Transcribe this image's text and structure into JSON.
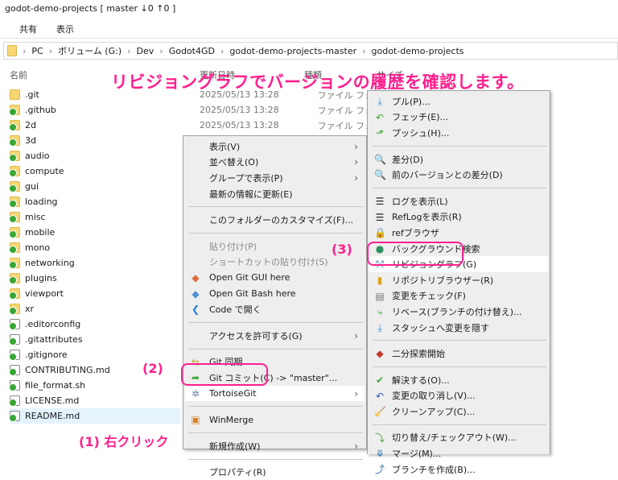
{
  "window": {
    "title": "godot-demo-projects [ master ↓0 ↑0 ]"
  },
  "ribbon": {
    "share": "共有",
    "view": "表示"
  },
  "breadcrumb": [
    "PC",
    "ボリューム (G:)",
    "Dev",
    "Godot4GD",
    "godot-demo-projects-master",
    "godot-demo-projects"
  ],
  "columns": {
    "name": "名前",
    "modified": "更新日時",
    "type": "種類",
    "size": "サイズ"
  },
  "banner": "リビジョングラフでバージョンの履歴を確認します。",
  "files": [
    {
      "name": ".git",
      "icon": "folder"
    },
    {
      "name": ".github",
      "icon": "git"
    },
    {
      "name": "2d",
      "icon": "git"
    },
    {
      "name": "3d",
      "icon": "git"
    },
    {
      "name": "audio",
      "icon": "git"
    },
    {
      "name": "compute",
      "icon": "git"
    },
    {
      "name": "gui",
      "icon": "git"
    },
    {
      "name": "loading",
      "icon": "git"
    },
    {
      "name": "misc",
      "icon": "git"
    },
    {
      "name": "mobile",
      "icon": "git"
    },
    {
      "name": "mono",
      "icon": "git"
    },
    {
      "name": "networking",
      "icon": "git"
    },
    {
      "name": "plugins",
      "icon": "git"
    },
    {
      "name": "viewport",
      "icon": "git"
    },
    {
      "name": "xr",
      "icon": "git"
    },
    {
      "name": ".editorconfig",
      "icon": "doc"
    },
    {
      "name": ".gitattributes",
      "icon": "doc"
    },
    {
      "name": ".gitignore",
      "icon": "doc"
    },
    {
      "name": "CONTRIBUTING.md",
      "icon": "doc"
    },
    {
      "name": "file_format.sh",
      "icon": "doc"
    },
    {
      "name": "LICENSE.md",
      "icon": "doc"
    },
    {
      "name": "README.md",
      "icon": "doc"
    }
  ],
  "visible_details": [
    {
      "date": "2025/05/13 13:28",
      "type": "ファイル フォルダー"
    },
    {
      "date": "2025/05/13 13:28",
      "type": "ファイル フォルダー"
    },
    {
      "date": "2025/05/13 13:28",
      "type": "ファイル フォルダー"
    }
  ],
  "context_menu": [
    {
      "label": "表示(V)",
      "sub": true
    },
    {
      "label": "並べ替え(O)",
      "sub": true
    },
    {
      "label": "グループで表示(P)",
      "sub": true
    },
    {
      "label": "最新の情報に更新(E)"
    },
    {
      "sep": true
    },
    {
      "label": "このフォルダーのカスタマイズ(F)..."
    },
    {
      "sep": true
    },
    {
      "label": "貼り付け(P)",
      "disabled": true
    },
    {
      "label": "ショートカットの貼り付け(S)",
      "disabled": true
    },
    {
      "label": "Open Git GUI here",
      "icon": "git-gui-icon",
      "glyph": "◆",
      "color": "#e06c3c"
    },
    {
      "label": "Open Git Bash here",
      "icon": "git-bash-icon",
      "glyph": "◆",
      "color": "#4a90d9"
    },
    {
      "label": "Code で開く",
      "icon": "vscode-icon",
      "glyph": "❮",
      "color": "#1f7fd6"
    },
    {
      "sep": true
    },
    {
      "label": "アクセスを許可する(G)",
      "sub": true
    },
    {
      "sep": true
    },
    {
      "label": "Git 同期...",
      "icon": "git-sync-icon",
      "glyph": "⇆",
      "color": "#c8a21a"
    },
    {
      "label": "Git コミット(C) -> \"master\"...",
      "icon": "git-commit-icon",
      "glyph": "➦",
      "color": "#3aa636"
    },
    {
      "label": "TortoiseGit",
      "icon": "tortoisegit-icon",
      "glyph": "✲",
      "color": "#6b7fa3",
      "sub": true,
      "highlight": true
    },
    {
      "sep": true
    },
    {
      "label": "WinMerge",
      "icon": "winmerge-icon",
      "glyph": "▣",
      "color": "#d9822b"
    },
    {
      "sep": true
    },
    {
      "label": "新規作成(W)",
      "sub": true
    },
    {
      "sep": true
    },
    {
      "label": "プロパティ(R)"
    }
  ],
  "tortoise_menu": [
    {
      "label": "プル(P)...",
      "icon": "pull-icon",
      "glyph": "⤓",
      "color": "#2f8fd8"
    },
    {
      "label": "フェッチ(E)...",
      "icon": "fetch-icon",
      "glyph": "↶",
      "color": "#3aa636"
    },
    {
      "label": "プッシュ(H)...",
      "icon": "push-icon",
      "glyph": "⬏",
      "color": "#3aa636"
    },
    {
      "sep": true
    },
    {
      "label": "差分(D)",
      "icon": "diff-icon",
      "glyph": "🔍",
      "color": "#2f6fb0"
    },
    {
      "label": "前のバージョンとの差分(D)",
      "icon": "diff-prev-icon",
      "glyph": "🔍",
      "color": "#2f6fb0"
    },
    {
      "sep": true
    },
    {
      "label": "ログを表示(L)",
      "icon": "log-icon",
      "glyph": "☰",
      "color": "#222"
    },
    {
      "label": "RefLogを表示(R)",
      "icon": "reflog-icon",
      "glyph": "☰",
      "color": "#222"
    },
    {
      "label": "refブラウザ",
      "icon": "ref-browser-icon",
      "glyph": "🔒",
      "color": "#d9a520"
    },
    {
      "label": "バックグラウンド検索",
      "icon": "globe-icon",
      "glyph": "●",
      "color": "#2f8f5f"
    },
    {
      "label": "リビジョングラフ(G)",
      "icon": "revision-graph-icon",
      "glyph": "⤱",
      "color": "#2f6fb0",
      "highlight": true
    },
    {
      "label": "リポジトリブラウザー(R)",
      "icon": "repo-browser-icon",
      "glyph": "▮",
      "color": "#d9a520"
    },
    {
      "label": "変更をチェック(F)",
      "icon": "check-changes-icon",
      "glyph": "▤",
      "color": "#777"
    },
    {
      "label": "リベース(ブランチの付け替え)...",
      "icon": "rebase-icon",
      "glyph": "⤷",
      "color": "#3aa636"
    },
    {
      "label": "スタッシュへ変更を隠す",
      "icon": "stash-icon",
      "glyph": "⤓",
      "color": "#2f8fd8"
    },
    {
      "sep": true
    },
    {
      "label": "二分探索開始",
      "icon": "bisect-icon",
      "glyph": "◆",
      "color": "#c0392b"
    },
    {
      "sep": true
    },
    {
      "label": "解決する(O)...",
      "icon": "resolve-icon",
      "glyph": "✔",
      "color": "#3aa636"
    },
    {
      "label": "変更の取り消し(V)...",
      "icon": "revert-icon",
      "glyph": "↶",
      "color": "#2f5fb0"
    },
    {
      "label": "クリーンアップ(C)...",
      "icon": "cleanup-icon",
      "glyph": "🧹",
      "color": "#8a6fb0"
    },
    {
      "sep": true
    },
    {
      "label": "切り替え/チェックアウト(W)...",
      "icon": "switch-icon",
      "glyph": "⤵",
      "color": "#3aa636"
    },
    {
      "label": "マージ(M)...",
      "icon": "merge-icon",
      "glyph": "⤋",
      "color": "#2f6fb0"
    },
    {
      "label": "ブランチを作成(B)...",
      "icon": "branch-icon",
      "glyph": "⤴",
      "color": "#2f6fb0"
    }
  ],
  "annotations": {
    "step1": "(1) 右クリック",
    "step2": "(2)",
    "step3": "(3)"
  }
}
